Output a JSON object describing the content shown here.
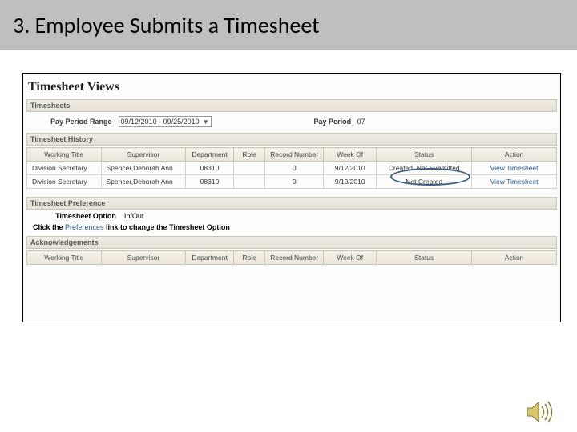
{
  "slide": {
    "title": "3.  Employee Submits a Timesheet"
  },
  "app": {
    "title": "Timesheet Views",
    "sections": {
      "timesheets": "Timesheets",
      "history": "Timesheet History",
      "preference": "Timesheet Preference",
      "acknowledgements": "Acknowledgements"
    },
    "filters": {
      "payPeriodRangeLabel": "Pay Period Range",
      "payPeriodRangeValue": "09/12/2010 - 09/25/2010",
      "payPeriodLabel": "Pay Period",
      "payPeriodValue": "07"
    },
    "historyTable": {
      "headers": [
        "Working Title",
        "Supervisor",
        "Department",
        "Role",
        "Record Number",
        "Week Of",
        "Status",
        "Action"
      ],
      "rows": [
        {
          "title": "Division Secretary",
          "supervisor": "Spencer,Deborah Ann",
          "dept": "08310",
          "role": "",
          "record": "0",
          "week": "9/12/2010",
          "status": "Created. Not Submitted",
          "action": "View Timesheet"
        },
        {
          "title": "Division Secretary",
          "supervisor": "Spencer,Deborah Ann",
          "dept": "08310",
          "role": "",
          "record": "0",
          "week": "9/19/2010",
          "status": "Not Created",
          "action": "View Timesheet"
        }
      ]
    },
    "preference": {
      "optionLabel": "Timesheet Option",
      "optionValue": "In/Out",
      "instructionPrefix": "Click the ",
      "instructionLink": "Preferences",
      "instructionSuffix": " link to change the Timesheet Option"
    },
    "ackTable": {
      "headers": [
        "Working Title",
        "Supervisor",
        "Department",
        "Role",
        "Record Number",
        "Week Of",
        "Status",
        "Action"
      ]
    }
  }
}
